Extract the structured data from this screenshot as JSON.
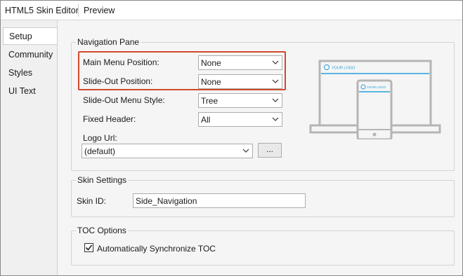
{
  "top_tabs": {
    "editor": "HTML5 Skin Editor",
    "preview": "Preview"
  },
  "side_tabs": [
    "Setup",
    "Community",
    "Styles",
    "UI Text"
  ],
  "nav_pane": {
    "title": "Navigation Pane",
    "main_menu_label": "Main Menu Position:",
    "main_menu_value": "None",
    "slideout_pos_label": "Slide-Out Position:",
    "slideout_pos_value": "None",
    "slideout_style_label": "Slide-Out Menu Style:",
    "slideout_style_value": "Tree",
    "fixed_header_label": "Fixed Header:",
    "fixed_header_value": "All",
    "logo_url_label": "Logo Url:",
    "logo_url_value": "(default)",
    "browse_label": "...",
    "preview_logo_text": "YOUR LOGO",
    "accent_color": "#2a9fd8"
  },
  "skin_settings": {
    "title": "Skin Settings",
    "skin_id_label": "Skin ID:",
    "skin_id_value": "Side_Navigation"
  },
  "toc_options": {
    "title": "TOC Options",
    "auto_sync_label": "Automatically Synchronize TOC",
    "auto_sync_checked": true
  }
}
